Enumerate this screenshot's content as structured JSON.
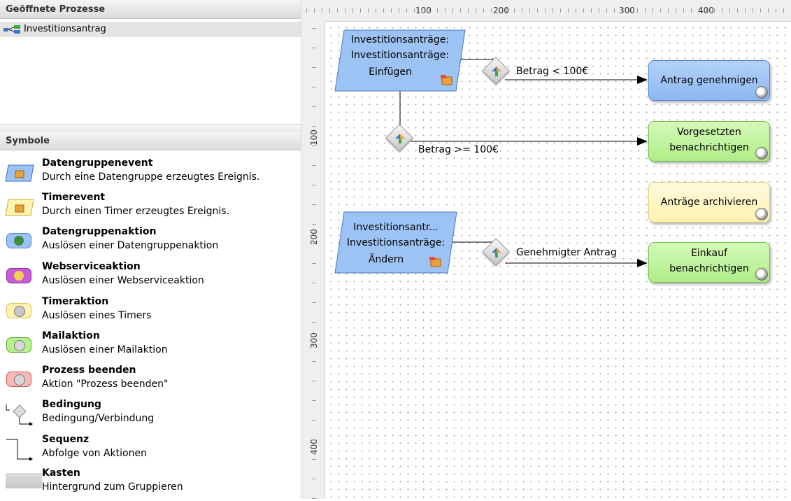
{
  "open_processes": {
    "header": "Geöffnete Prozesse",
    "items": [
      {
        "label": "Investitionsantrag"
      }
    ]
  },
  "symbols": {
    "header": "Symbole",
    "items": [
      {
        "title": "Datengruppenevent",
        "desc": "Durch eine Datengruppe erzeugtes Ereignis.",
        "icon": "datengruppenevent-icon"
      },
      {
        "title": "Timerevent",
        "desc": "Durch einen Timer erzeugtes Ereignis.",
        "icon": "timerevent-icon"
      },
      {
        "title": "Datengruppenaktion",
        "desc": "Auslösen einer Datengruppenaktion",
        "icon": "datengruppenaktion-icon",
        "color": "#9dc3f5"
      },
      {
        "title": "Webserviceaktion",
        "desc": "Auslösen einer Webserviceaktion",
        "icon": "webserviceaktion-icon",
        "color": "#c85ad8"
      },
      {
        "title": "Timeraktion",
        "desc": "Auslösen eines Timers",
        "icon": "timeraktion-icon",
        "color": "#fff3b0"
      },
      {
        "title": "Mailaktion",
        "desc": "Auslösen einer Mailaktion",
        "icon": "mailaktion-icon",
        "color": "#b8f08e"
      },
      {
        "title": "Prozess beenden",
        "desc": "Aktion \"Prozess beenden\"",
        "icon": "prozess-beenden-icon",
        "color": "#f8b8b8"
      },
      {
        "title": "Bedingung",
        "desc": "Bedingung/Verbindung",
        "icon": "bedingung-icon"
      },
      {
        "title": "Sequenz",
        "desc": "Abfolge von Aktionen",
        "icon": "sequenz-icon"
      },
      {
        "title": "Kasten",
        "desc": "Hintergrund zum Gruppieren",
        "icon": "kasten-icon"
      }
    ]
  },
  "ruler": {
    "top_labels": [
      "100",
      "200",
      "300",
      "400"
    ],
    "left_labels": [
      "100",
      "200",
      "300",
      "400"
    ]
  },
  "diagram": {
    "event1": {
      "line1": "Investitionsanträge:",
      "line2": "Investitionsanträge:",
      "line3": "Einfügen"
    },
    "event2": {
      "line1": "Investitionsantr...",
      "line2": "Investitionsanträge:",
      "line3": "Ändern"
    },
    "cond1": "Betrag < 100€",
    "cond2": "Betrag >= 100€",
    "cond3": "Genehmigter Antrag",
    "action1": "Antrag genehmigen",
    "action2_line1": "Vorgesetzten",
    "action2_line2": "benachrichtigen",
    "action3": "Anträge archivieren",
    "action4_line1": "Einkauf",
    "action4_line2": "benachrichtigen",
    "colors": {
      "event": "#9dc3f5",
      "data_action": "#9dc3f5",
      "mail_action": "#b8f08e",
      "timer_action": "#fff3b0"
    }
  }
}
